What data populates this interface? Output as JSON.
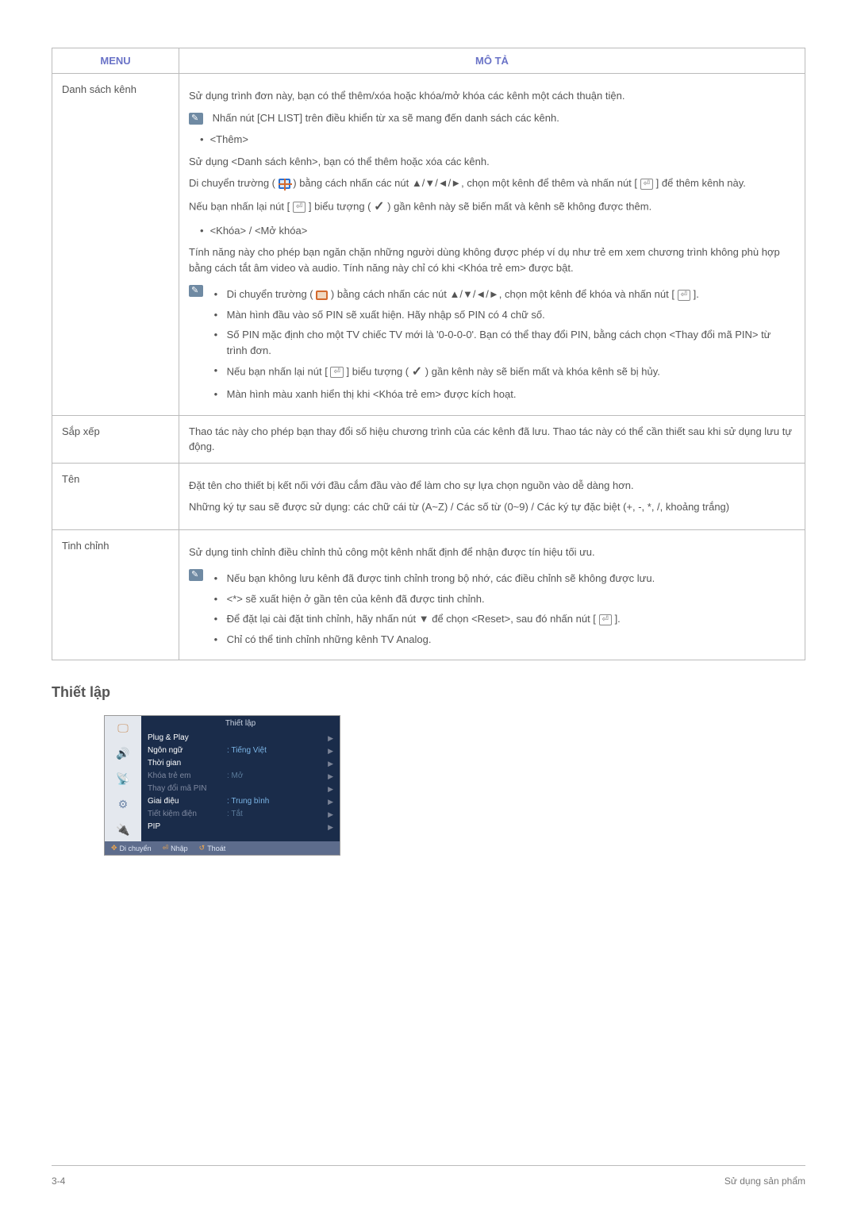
{
  "table": {
    "headers": {
      "menu": "MENU",
      "desc": "MÔ TẢ"
    },
    "rows": [
      {
        "menu": "Danh sách kênh",
        "p1": "Sử dụng trình đơn này, bạn có thể thêm/xóa hoặc khóa/mở khóa các kênh một cách thuận tiện.",
        "note1": "Nhấn nút [CH LIST] trên điều khiển từ xa sẽ mang đến danh sách các kênh.",
        "bullet_add": "<Thêm>",
        "p_add": "Sử dụng <Danh sách kênh>, bạn có thể thêm hoặc xóa các kênh.",
        "p_move1_a": "Di chuyển trường (",
        "p_move1_b": ") bằng cách nhấn các nút ▲/▼/◄/►, chọn một kênh để thêm và nhấn nút [",
        "p_move1_c": "] để thêm kênh này.",
        "p_again_a": "Nếu bạn nhấn lại nút [",
        "p_again_b": "] biểu tượng (",
        "p_again_c": ") gần kênh này sẽ biến mất và kênh sẽ không được thêm.",
        "bullet_lock": "<Khóa> / <Mở khóa>",
        "p_lock": "Tính năng này cho phép bạn ngăn chặn những người dùng không được phép ví dụ như trẻ em xem chương trình không phù hợp bằng cách tắt âm video và audio. Tính năng này chỉ có khi <Khóa trẻ em> được bật.",
        "note2": {
          "l1a": "Di chuyển trường (",
          "l1b": ") bằng cách nhấn các nút ▲/▼/◄/►, chọn một kênh để khóa và nhấn nút [",
          "l1c": "].",
          "l2": "Màn hình đầu vào số PIN sẽ xuất hiện. Hãy nhập số PIN có 4 chữ số.",
          "l3": "Số PIN mặc định cho một TV chiếc TV mới là '0-0-0-0'. Bạn có thể thay đổi PIN, bằng cách chọn <Thay đổi mã PIN> từ trình đơn.",
          "l4a": "Nếu bạn nhấn lại nút [",
          "l4b": "] biểu tượng (",
          "l4c": ") gần kênh này sẽ biến mất và khóa kênh sẽ bị hủy.",
          "l5": "Màn hình màu xanh hiển thị khi <Khóa trẻ em> được kích hoạt."
        }
      },
      {
        "menu": "Sắp xếp",
        "p1": "Thao tác này cho phép bạn thay đổi số hiệu chương trình của các kênh đã lưu. Thao tác này có thể cần thiết sau khi sử dụng lưu tự động."
      },
      {
        "menu": "Tên",
        "p1": "Đặt tên cho thiết bị kết nối với đầu cắm đầu vào để làm cho sự lựa chọn nguồn vào dễ dàng hơn.",
        "p2": "Những ký tự sau sẽ được sử dụng: các chữ cái từ (A~Z) / Các số từ (0~9) / Các ký tự đặc biệt (+, -, *, /, khoảng trắng)"
      },
      {
        "menu": "Tinh chỉnh",
        "p1": "Sử dụng tinh chỉnh điều chỉnh thủ công một kênh nhất định để nhận được tín hiệu tối ưu.",
        "note": {
          "l1": "Nếu bạn không lưu kênh đã được tinh chỉnh trong bộ nhớ, các điều chỉnh sẽ không được lưu.",
          "l2": "<*> sẽ xuất hiện ở gần tên của kênh đã được tinh chỉnh.",
          "l3a": "Để đặt lại cài đặt tinh chỉnh, hãy nhấn nút ▼ để chọn <Reset>, sau đó nhấn nút [",
          "l3b": "].",
          "l4": "Chỉ có thể tinh chỉnh những kênh TV Analog."
        }
      }
    ]
  },
  "section_title": "Thiết lập",
  "osd": {
    "title": "Thiết lập",
    "items": [
      {
        "label": "Plug & Play",
        "val": "",
        "active": true
      },
      {
        "label": "Ngôn ngữ",
        "val": ": Tiếng Việt",
        "active": true
      },
      {
        "label": "Thời gian",
        "val": "",
        "active": true
      },
      {
        "label": "Khóa trẻ em",
        "val": ": Mở",
        "dim": true
      },
      {
        "label": "Thay đổi mã PIN",
        "val": "",
        "dim": true
      },
      {
        "label": "Giai điệu",
        "val": ": Trung bình",
        "active": true
      },
      {
        "label": "Tiết kiệm điện",
        "val": ": Tắt",
        "dim": true
      },
      {
        "label": "PIP",
        "val": "",
        "active": true
      }
    ],
    "footer": {
      "move": "Di chuyển",
      "enter": "Nhập",
      "return": "Thoát"
    }
  },
  "footer": {
    "page": "3-4",
    "label": "Sử dụng sản phẩm"
  }
}
